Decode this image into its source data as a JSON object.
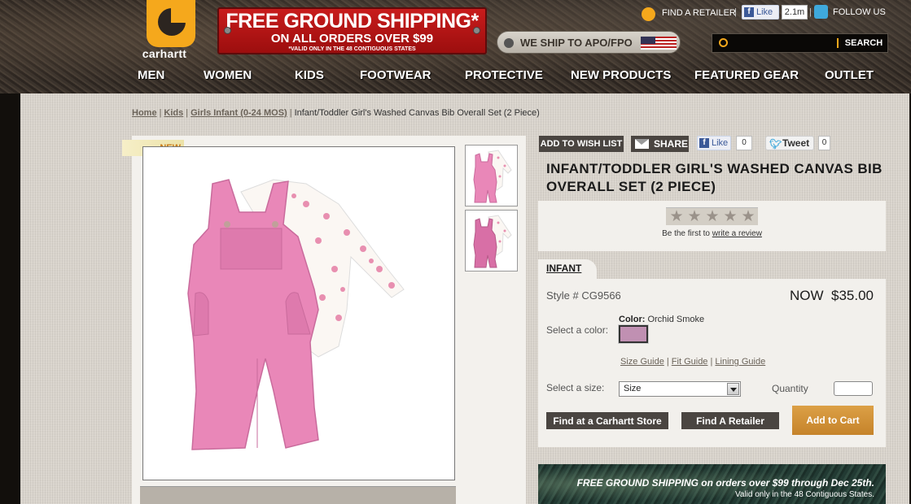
{
  "header": {
    "logo_text": "carhartt",
    "promo": {
      "line1": "FREE GROUND SHIPPING*",
      "line2": "ON ALL ORDERS OVER $99",
      "line3": "*VALID ONLY IN THE 48 CONTIGUOUS STATES"
    },
    "apo_text": "WE SHIP TO APO/FPO",
    "find_retailer": "FIND A RETAILER",
    "fb_like": "Like",
    "fb_count": "2.1m",
    "follow_us": "FOLLOW US",
    "separator": "|",
    "search": {
      "placeholder": "",
      "button": "SEARCH"
    }
  },
  "nav": [
    "MEN",
    "WOMEN",
    "KIDS",
    "FOOTWEAR",
    "PROTECTIVE",
    "NEW PRODUCTS",
    "FEATURED GEAR",
    "OUTLET"
  ],
  "breadcrumb": {
    "items": [
      "Home",
      "Kids",
      "Girls Infant (0-24 MOS)"
    ],
    "current": "Infant/Toddler Girl's Washed Canvas Bib Overall Set (2 Piece)",
    "separator": "|"
  },
  "product": {
    "badge": "NEW",
    "title": "INFANT/TODDLER GIRL'S WASHED CANVAS BIB OVERALL SET (2 PIECE)",
    "actions": {
      "wishlist": "ADD TO WISH LIST",
      "share": "SHARE",
      "like": "Like",
      "like_count": "0",
      "tweet": "Tweet",
      "tweet_count": "0"
    },
    "rating": {
      "stars": 0,
      "max_stars": 5,
      "text": "Be the first to",
      "link": "write a review"
    },
    "tab": "INFANT",
    "style": "Style # CG9566",
    "price_label": "NOW",
    "price": "$35.00",
    "color_heading": "Color:",
    "color_name": "Orchid Smoke",
    "color_hex": "#c090b2",
    "select_color_label": "Select a color:",
    "guides": [
      "Size Guide",
      "Fit Guide",
      "Lining Guide"
    ],
    "guide_separator": "|",
    "select_size_label": "Select a size:",
    "size_value": "Size",
    "quantity_label": "Quantity",
    "quantity_value": "",
    "buttons": {
      "find_store": "Find at a Carhartt Store",
      "find_retailer": "Find A Retailer",
      "add_to_cart": "Add to Cart"
    }
  },
  "bottom_promo": {
    "line1": "FREE GROUND SHIPPING on orders over $99 through Dec 25th.",
    "line2": "Valid only in the 48 Contiguous States."
  },
  "colors": {
    "brand_orange": "#f5a81c",
    "promo_red": "#c81c1c",
    "button_dark": "#4a4541",
    "cart_gold": "#c5832a",
    "overall_pink": "#e987b8"
  }
}
